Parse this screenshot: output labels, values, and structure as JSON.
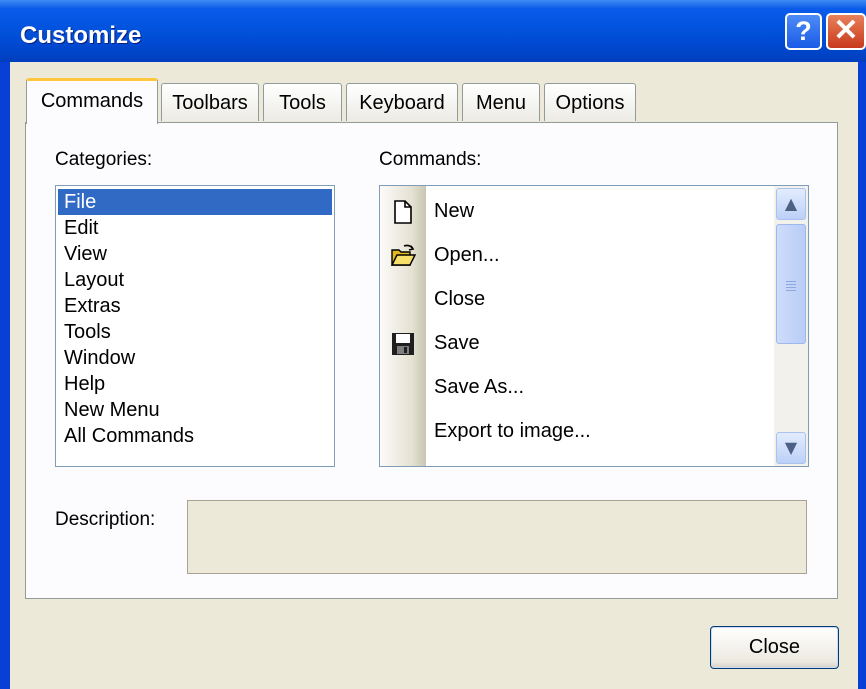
{
  "window": {
    "title": "Customize",
    "help_glyph": "?",
    "close_glyph": "✕"
  },
  "tabs": [
    {
      "label": "Commands",
      "active": true
    },
    {
      "label": "Toolbars",
      "active": false
    },
    {
      "label": "Tools",
      "active": false
    },
    {
      "label": "Keyboard",
      "active": false
    },
    {
      "label": "Menu",
      "active": false
    },
    {
      "label": "Options",
      "active": false
    }
  ],
  "categories": {
    "label": "Categories:",
    "items": [
      "File",
      "Edit",
      "View",
      "Layout",
      "Extras",
      "Tools",
      "Window",
      "Help",
      "New Menu",
      "All Commands"
    ],
    "selected": "File"
  },
  "commands": {
    "label": "Commands:",
    "items": [
      {
        "label": "New",
        "icon": "new-document-icon"
      },
      {
        "label": "Open...",
        "icon": "open-folder-icon"
      },
      {
        "label": "Close",
        "icon": ""
      },
      {
        "label": "Save",
        "icon": "floppy-disk-icon"
      },
      {
        "label": "Save As...",
        "icon": ""
      },
      {
        "label": "Export to image...",
        "icon": ""
      }
    ]
  },
  "description": {
    "label": "Description:",
    "text": ""
  },
  "footer": {
    "close_label": "Close"
  },
  "colors": {
    "titlebar": "#0055e5",
    "dialog_bg": "#ece9d8",
    "selection": "#316ac5",
    "active_tab_accent": "#ffc83c"
  }
}
